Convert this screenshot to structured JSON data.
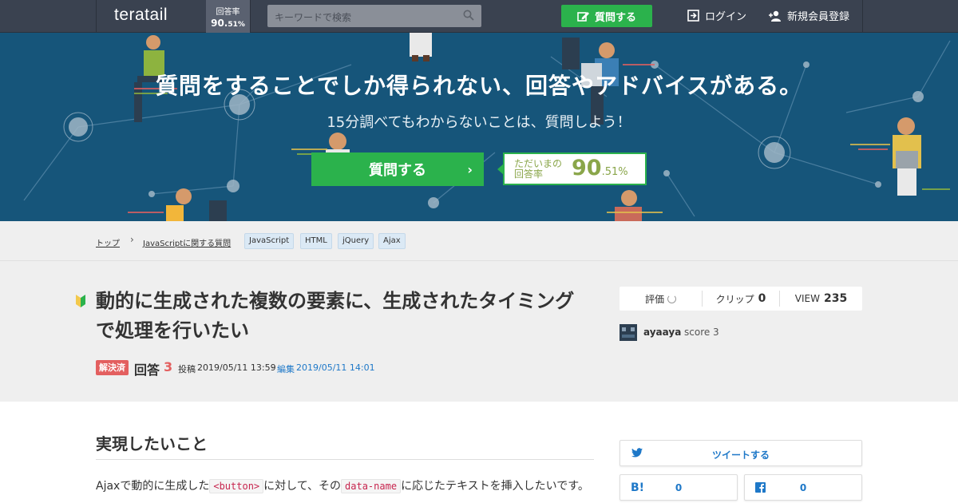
{
  "header": {
    "logo": "teratail",
    "rate_label": "回答率",
    "rate_main": "90.",
    "rate_decimal": "51%",
    "search_placeholder": "キーワードで検索",
    "ask_button": "質問する",
    "login": "ログイン",
    "signup": "新規会員登録"
  },
  "hero": {
    "title": "質問をすることでしか得られない、回答やアドバイスがある。",
    "subtitle": "15分調べてもわからないことは、質問しよう！",
    "ask_button": "質問する",
    "rate_label_1": "ただいまの",
    "rate_label_2": "回答率",
    "rate_main": "90",
    "rate_decimal": ".51%"
  },
  "breadcrumb": {
    "top": "トップ",
    "category": "JavaScriptに関する質問",
    "tags": [
      "JavaScript",
      "HTML",
      "jQuery",
      "Ajax"
    ]
  },
  "question": {
    "title": "動的に生成された複数の要素に、生成されたタイミングで処理を行いたい",
    "status": "解決済",
    "answers_label": "回答",
    "answers_count": "3",
    "posted_label": "投稿",
    "posted_at": "2019/05/11 13:59",
    "edit_label": "編集",
    "edited_at": "2019/05/11 14:01"
  },
  "stats": {
    "rating_label": "評価",
    "clip_label": "クリップ",
    "clip_count": "0",
    "view_label": "VIEW",
    "view_count": "235"
  },
  "author": {
    "name": "ayaaya",
    "score": "score 3"
  },
  "content": {
    "section_title": "実現したいこと",
    "para_1": "Ajaxで動的に生成した",
    "code_1": "<button>",
    "para_2": "に対して、その",
    "code_2": "data-name",
    "para_3": "に応じたテキストを挿入したいです。"
  },
  "share": {
    "tweet": "ツイートする",
    "hatena_count": "0",
    "facebook_count": "0"
  },
  "colors": {
    "header_bg": "#3a4250",
    "hero_bg": "#16557a",
    "accent_green": "#2bb24c",
    "solved_red": "#e35f5f",
    "link_blue": "#1e78c8"
  }
}
